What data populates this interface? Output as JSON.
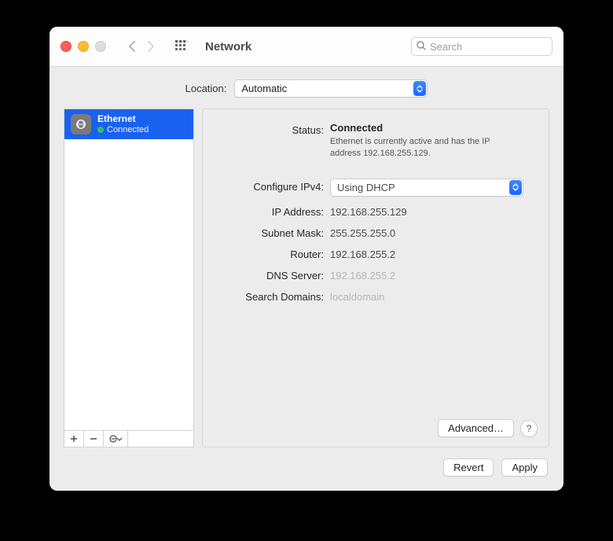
{
  "toolbar": {
    "title": "Network",
    "search_placeholder": "Search"
  },
  "location": {
    "label": "Location:",
    "value": "Automatic"
  },
  "sidebar": {
    "items": [
      {
        "name": "Ethernet",
        "status": "Connected"
      }
    ],
    "buttons": {
      "add": "＋",
      "remove": "－",
      "more": "⊖"
    }
  },
  "detail": {
    "status_label": "Status:",
    "status_value": "Connected",
    "status_sub": "Ethernet is currently active and has the IP address 192.168.255.129.",
    "configure_label": "Configure IPv4:",
    "configure_value": "Using DHCP",
    "ip_label": "IP Address:",
    "ip_value": "192.168.255.129",
    "subnet_label": "Subnet Mask:",
    "subnet_value": "255.255.255.0",
    "router_label": "Router:",
    "router_value": "192.168.255.2",
    "dns_label": "DNS Server:",
    "dns_value": "192.168.255.2",
    "search_label": "Search Domains:",
    "search_value": "localdomain",
    "advanced": "Advanced…",
    "help": "?"
  },
  "footer": {
    "revert": "Revert",
    "apply": "Apply"
  }
}
